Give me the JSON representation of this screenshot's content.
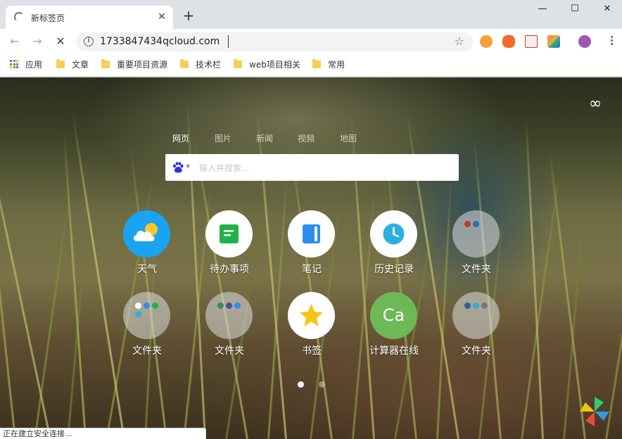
{
  "window": {
    "tab_title": "新标签页",
    "close_tab": "✕",
    "new_tab": "+",
    "minimize": "—",
    "maximize": "☐",
    "close_window": "✕"
  },
  "toolbar": {
    "back": "←",
    "forward": "→",
    "stop": "✕",
    "info_icon": "i",
    "url": "1733847434qcloud.com",
    "star": "☆"
  },
  "bookmarks": {
    "apps": "应用",
    "items": [
      "文章",
      "重要项目资源",
      "技术栏",
      "web项目相关",
      "常用"
    ]
  },
  "ntp": {
    "infinity": "∞",
    "search_tabs": [
      "网页",
      "图片",
      "新闻",
      "视频",
      "地图"
    ],
    "search_placeholder": "输入并搜索...",
    "tiles": [
      {
        "label": "天气"
      },
      {
        "label": "待办事项"
      },
      {
        "label": "笔记"
      },
      {
        "label": "历史记录"
      },
      {
        "label": "文件夹"
      },
      {
        "label": "文件夹"
      },
      {
        "label": "文件夹"
      },
      {
        "label": "书签"
      },
      {
        "label": "计算器在线",
        "glyph": "Ca"
      },
      {
        "label": "文件夹"
      }
    ],
    "page_dots": 2,
    "current_page": 1
  },
  "status": {
    "text": "正在建立安全连接..."
  },
  "colors": {
    "weather_blue": "#1aa3f0",
    "todo_green": "#1fb24a",
    "note_blue": "#2a8ef0",
    "history_cyan": "#2ab0e0",
    "calc_green": "#6cb956",
    "star_yellow": "#f5c518"
  }
}
